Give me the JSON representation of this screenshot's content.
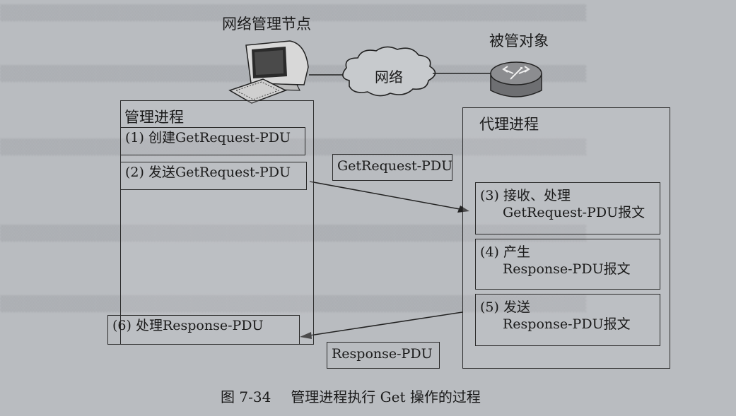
{
  "diagram": {
    "node_manager": "网络管理节点",
    "node_network": "网络",
    "node_managed": "被管对象",
    "manager_process": {
      "title": "管理进程",
      "steps": [
        "(1) 创建GetRequest-PDU",
        "(2) 发送GetRequest-PDU",
        "(6) 处理Response-PDU"
      ]
    },
    "agent_process": {
      "title": "代理进程",
      "steps": [
        {
          "line1": "(3) 接收、处理",
          "line2": "GetRequest-PDU报文"
        },
        {
          "line1": "(4) 产生",
          "line2": "Response-PDU报文"
        },
        {
          "line1": "(5) 发送",
          "line2": "Response-PDU报文"
        }
      ]
    },
    "messages": {
      "request": "GetRequest-PDU",
      "response": "Response-PDU"
    },
    "caption": {
      "number": "图 7-34",
      "text": "管理进程执行 Get 操作的过程"
    }
  },
  "colors": {
    "paper": "#b9bcc0",
    "ink": "#1a1a1a"
  },
  "icons": [
    "computer-icon",
    "cloud-icon",
    "router-icon"
  ]
}
